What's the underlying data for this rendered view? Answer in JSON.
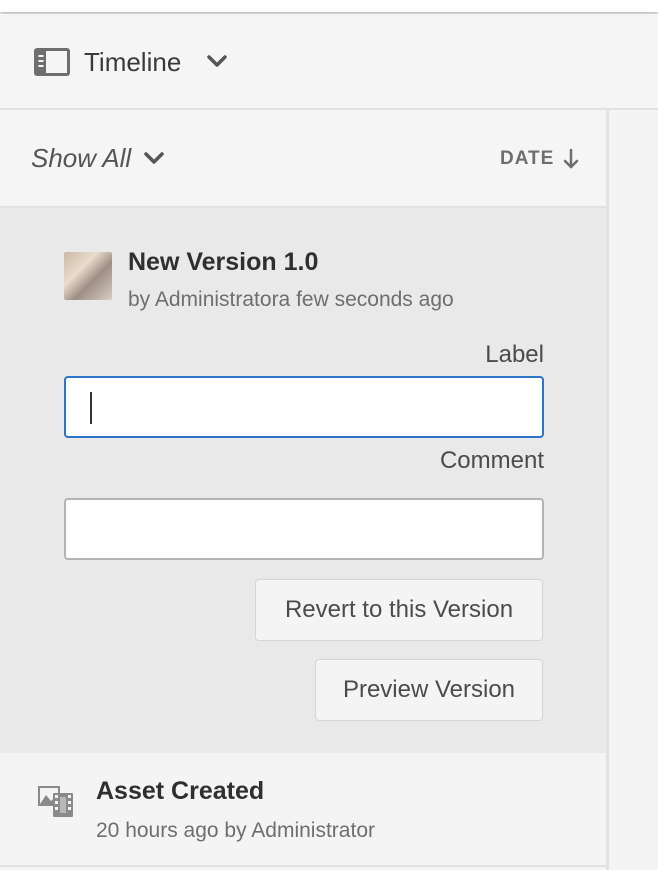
{
  "header": {
    "title": "Timeline",
    "icon": "rail-toggle-icon"
  },
  "filter": {
    "show_label": "Show All",
    "sort_label": "DATE"
  },
  "version_item": {
    "title": "New Version 1.0",
    "meta": "by Administratora few seconds ago",
    "label_caption": "Label",
    "label_value": "",
    "comment_caption": "Comment",
    "comment_value": "",
    "revert_button": "Revert to this Version",
    "preview_button": "Preview Version"
  },
  "asset_item": {
    "title": "Asset Created",
    "meta": "20 hours ago by Administrator",
    "icon": "asset-image-icon"
  },
  "colors": {
    "focus_border": "#2c76c9",
    "selected_bg": "#e9e9e9",
    "panel_bg": "#f4f4f4"
  }
}
